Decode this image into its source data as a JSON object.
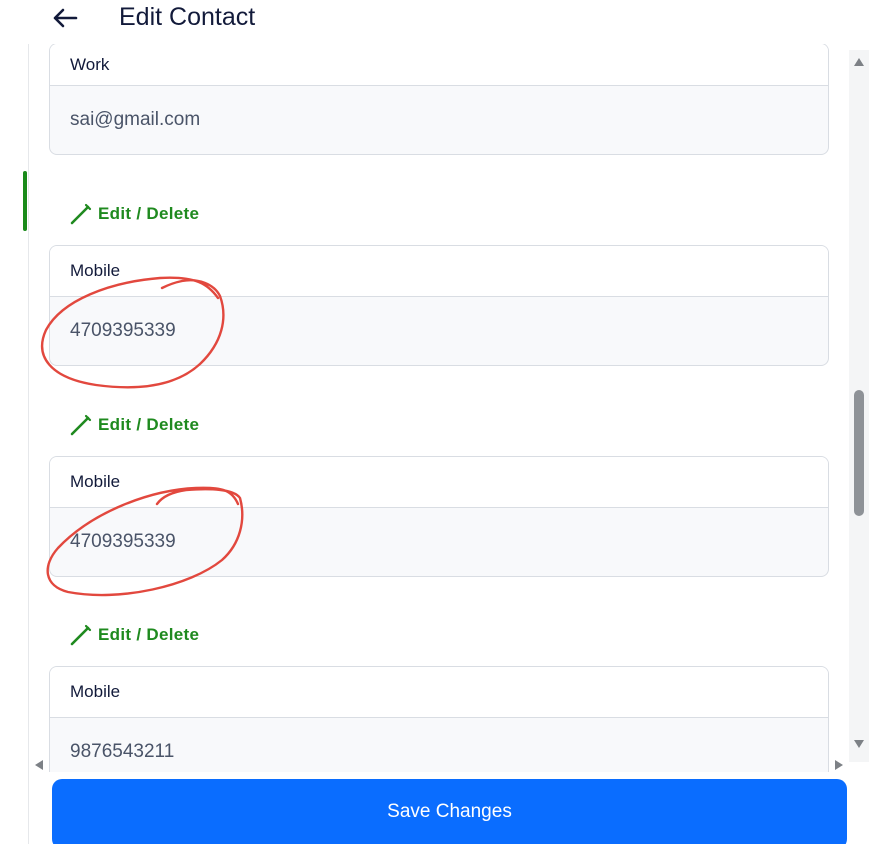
{
  "header": {
    "title": "Edit Contact",
    "back_icon": "arrow-left-icon"
  },
  "fields": [
    {
      "label": "Work",
      "value": "sai@gmail.com"
    },
    {
      "label": "Mobile",
      "value": "4709395339"
    },
    {
      "label": "Mobile",
      "value": "4709395339"
    },
    {
      "label": "Mobile",
      "value": "9876543211"
    }
  ],
  "actions": {
    "edit_delete_label": "Edit / Delete",
    "edit_icon": "pencil-icon"
  },
  "footer": {
    "save_label": "Save Changes"
  },
  "colors": {
    "accent_green": "#1f8a1f",
    "primary_blue": "#0a6dff",
    "annotation_red": "#e2483e",
    "title_navy": "#121a3a"
  }
}
